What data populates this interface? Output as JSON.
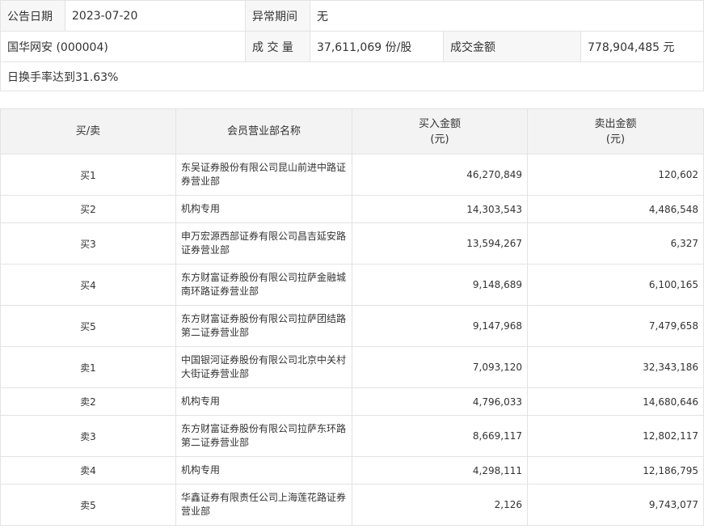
{
  "info": {
    "announce_date_label": "公告日期",
    "announce_date_value": "2023-07-20",
    "abnormal_period_label": "异常期间",
    "abnormal_period_value": "无",
    "stock_name": "国华网安 (000004)",
    "volume_label": "成 交 量",
    "volume_value": "37,611,069 份/股",
    "amount_label": "成交金额",
    "amount_value": "778,904,485 元",
    "reason": "日换手率达到31.63%"
  },
  "trades": {
    "headers": {
      "side": "买/卖",
      "dept": "会员营业部名称",
      "buy_line1": "买入金额",
      "buy_line2": "(元)",
      "sell_line1": "卖出金额",
      "sell_line2": "(元)"
    },
    "rows": [
      {
        "side": "买1",
        "dept": "东吴证券股份有限公司昆山前进中路证券营业部",
        "buy": "46,270,849",
        "sell": "120,602"
      },
      {
        "side": "买2",
        "dept": "机构专用",
        "buy": "14,303,543",
        "sell": "4,486,548"
      },
      {
        "side": "买3",
        "dept": "申万宏源西部证券有限公司昌吉延安路证券营业部",
        "buy": "13,594,267",
        "sell": "6,327"
      },
      {
        "side": "买4",
        "dept": "东方财富证券股份有限公司拉萨金融城南环路证券营业部",
        "buy": "9,148,689",
        "sell": "6,100,165"
      },
      {
        "side": "买5",
        "dept": "东方财富证券股份有限公司拉萨团结路第二证券营业部",
        "buy": "9,147,968",
        "sell": "7,479,658"
      },
      {
        "side": "卖1",
        "dept": "中国银河证券股份有限公司北京中关村大街证券营业部",
        "buy": "7,093,120",
        "sell": "32,343,186"
      },
      {
        "side": "卖2",
        "dept": "机构专用",
        "buy": "4,796,033",
        "sell": "14,680,646"
      },
      {
        "side": "卖3",
        "dept": "东方财富证券股份有限公司拉萨东环路第二证券营业部",
        "buy": "8,669,117",
        "sell": "12,802,117"
      },
      {
        "side": "卖4",
        "dept": "机构专用",
        "buy": "4,298,111",
        "sell": "12,186,795"
      },
      {
        "side": "卖5",
        "dept": "华鑫证券有限责任公司上海莲花路证券营业部",
        "buy": "2,126",
        "sell": "9,743,077"
      }
    ]
  }
}
